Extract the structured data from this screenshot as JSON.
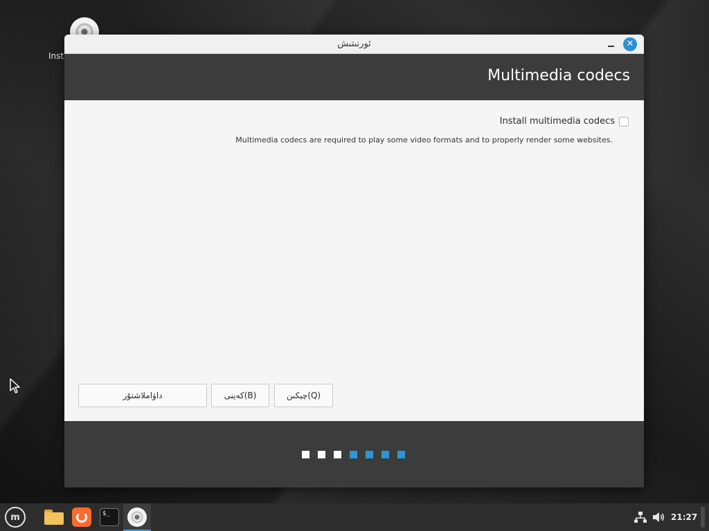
{
  "desktop": {
    "installer_icon_label": "Inst"
  },
  "window": {
    "title": "ئورنىتىش",
    "heading": "Multimedia codecs",
    "install_codecs_label": "Install multimedia codecs",
    "install_codecs_checked": false,
    "description": "Multimedia codecs are required to play some video formats and to properly render some websites.",
    "buttons": {
      "continue": "داۋاملاشتۇر",
      "back": "كەينى(B)",
      "quit": "چېكىن(Q)"
    },
    "progress": {
      "total_steps": 7,
      "completed_steps": 3,
      "colors": {
        "done": "#ffffff",
        "pending": "#2f95d8"
      }
    }
  },
  "taskbar": {
    "items": [
      "menu-icon",
      "files-icon",
      "firefox-icon",
      "terminal-icon",
      "installer-icon"
    ],
    "clock": "21:27"
  },
  "colors": {
    "accent": "#2d8fd5",
    "header_bg": "#3c3c3c",
    "window_bg": "#f5f5f5"
  }
}
